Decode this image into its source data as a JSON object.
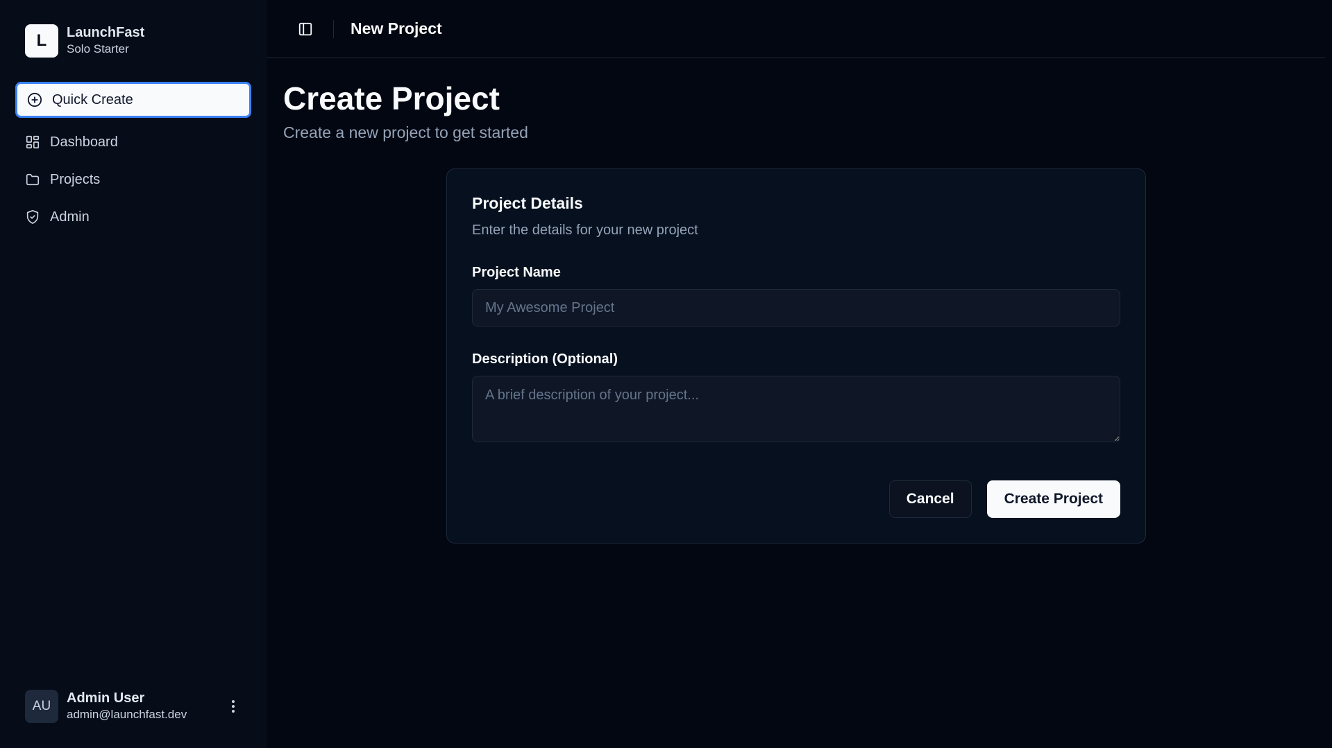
{
  "brand": {
    "logo_letter": "L",
    "name": "LaunchFast",
    "plan": "Solo Starter"
  },
  "sidebar": {
    "quick_create": {
      "label": "Quick Create",
      "icon": "plus-circle-icon"
    },
    "items": [
      {
        "label": "Dashboard",
        "icon": "grid-icon"
      },
      {
        "label": "Projects",
        "icon": "folder-icon"
      },
      {
        "label": "Admin",
        "icon": "shield-icon"
      }
    ]
  },
  "user": {
    "initials": "AU",
    "name": "Admin User",
    "email": "admin@launchfast.dev"
  },
  "topbar": {
    "title": "New Project"
  },
  "page": {
    "title": "Create Project",
    "subtitle": "Create a new project to get started"
  },
  "card": {
    "title": "Project Details",
    "description": "Enter the details for your new project",
    "name_label": "Project Name",
    "name_placeholder": "My Awesome Project",
    "name_value": "",
    "desc_label": "Description (Optional)",
    "desc_placeholder": "A brief description of your project...",
    "desc_value": "",
    "cancel_label": "Cancel",
    "submit_label": "Create Project"
  },
  "colors": {
    "accent": "#3b82f6",
    "background": "#030711",
    "sidebar": "#060c18"
  }
}
